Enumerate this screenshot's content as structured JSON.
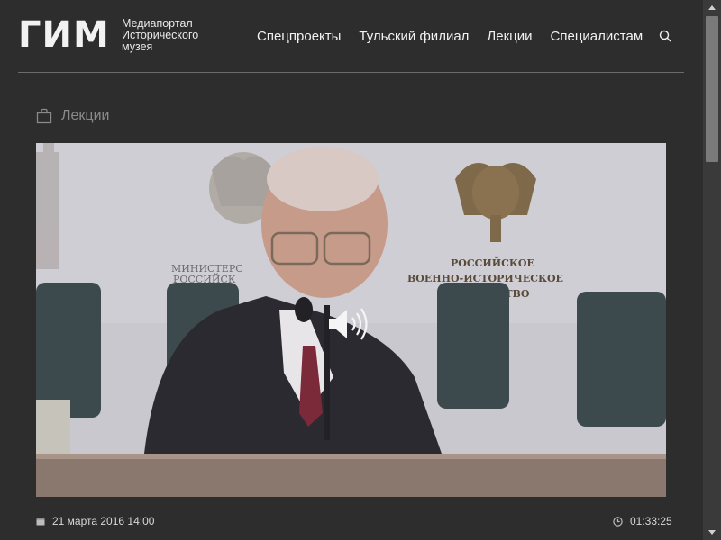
{
  "header": {
    "logo_text": "ГИМ",
    "portal_line1": "Медиапортал",
    "portal_line2": "Исторического",
    "portal_line3": "музея",
    "nav": [
      "Спецпроекты",
      "Тульский филиал",
      "Лекции",
      "Специалистам"
    ],
    "search_icon": "search-icon"
  },
  "breadcrumb": {
    "icon": "bag-icon",
    "label": "Лекции"
  },
  "video": {
    "volume_icon": "volume-icon",
    "backdrop_left_text_1": "МИНИСТЕРС",
    "backdrop_left_text_2": "РОССИЙСК",
    "backdrop_right_text_1": "РОССИЙСКОЕ",
    "backdrop_right_text_2": "ВОЕННО-ИСТОРИЧЕСКОЕ",
    "backdrop_right_text_3": "ОБЩЕСТВО"
  },
  "meta": {
    "date_icon": "calendar-icon",
    "date": "21 марта 2016 14:00",
    "duration_icon": "clock-icon",
    "duration": "01:33:25"
  },
  "colors": {
    "background": "#2d2d2d",
    "text": "#f2f2f2",
    "muted": "#8a8a8a"
  }
}
